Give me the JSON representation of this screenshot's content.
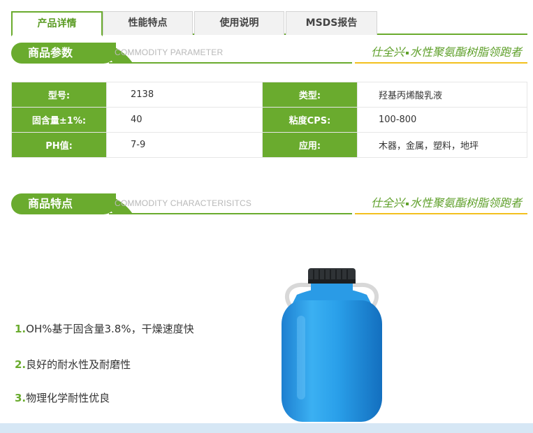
{
  "tabs": [
    {
      "label": "产品详情"
    },
    {
      "label": "性能特点"
    },
    {
      "label": "使用说明"
    },
    {
      "label": "MSDS报告"
    }
  ],
  "section_params": {
    "title": "商品参数",
    "subtitle": "COMMODITY PARAMETER",
    "brand_a": "仕全兴",
    "brand_b": "水性聚氨酯树脂领跑者"
  },
  "params": {
    "rows": [
      {
        "k1": "型号:",
        "v1": "2138",
        "k2": "类型:",
        "v2": "羟基丙烯酸乳液"
      },
      {
        "k1": "固含量±1%:",
        "v1": "40",
        "k2": "粘度CPS:",
        "v2": "100-800"
      },
      {
        "k1": "PH值:",
        "v1": "7-9",
        "k2": "应用:",
        "v2": "木器，金属，塑料，地坪"
      }
    ]
  },
  "section_features": {
    "title": "商品特点",
    "subtitle": "COMMODITY CHARACTERISITCS",
    "brand_a": "仕全兴",
    "brand_b": "水性聚氨酯树脂领跑者"
  },
  "features": [
    {
      "num": "1.",
      "text": "OH%基于固含量3.8%，干燥速度快"
    },
    {
      "num": "2.",
      "text": "良好的耐水性及耐磨性"
    },
    {
      "num": "3.",
      "text": "物理化学耐性优良"
    }
  ],
  "colors": {
    "accent": "#6aab2e",
    "brand_line": "#f3c01e",
    "drum": "#2b9be6"
  }
}
